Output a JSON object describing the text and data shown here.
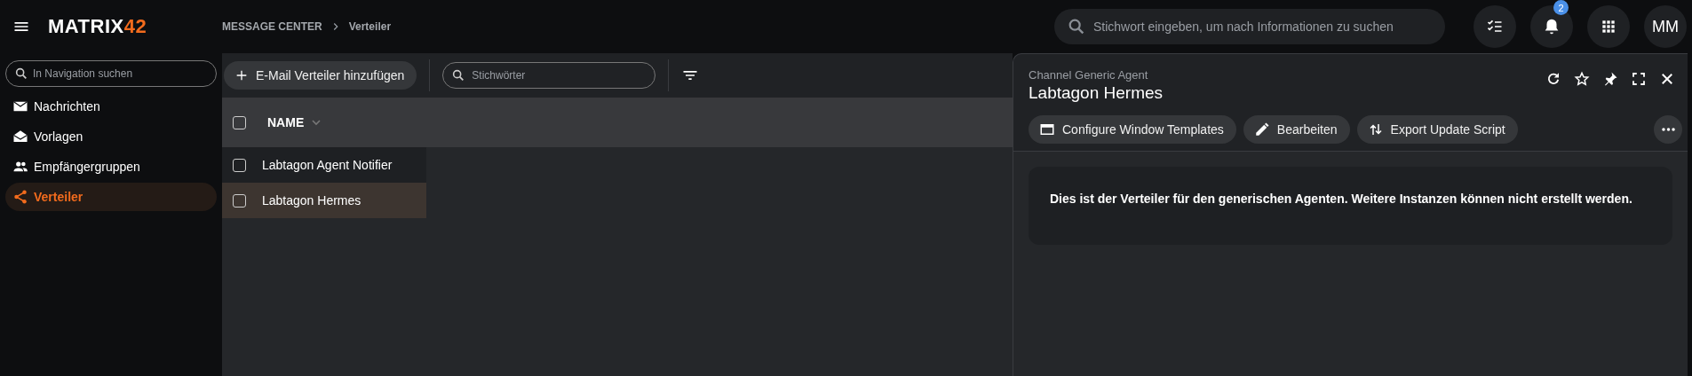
{
  "header": {
    "logo": {
      "name": "MATRIX",
      "number": "42"
    },
    "breadcrumb": [
      "MESSAGE CENTER",
      "Verteiler"
    ],
    "search": {
      "placeholder": "Stichwort eingeben, um nach Informationen zu suchen"
    },
    "notifications": {
      "count": "2"
    },
    "avatar": "MM"
  },
  "sidebar": {
    "search": {
      "placeholder": "In Navigation suchen"
    },
    "items": [
      {
        "label": "Nachrichten",
        "selected": false
      },
      {
        "label": "Vorlagen",
        "selected": false
      },
      {
        "label": "Empfängergruppen",
        "selected": false
      },
      {
        "label": "Verteiler",
        "selected": true
      }
    ]
  },
  "toolbar": {
    "add_button": "E-Mail Verteiler hinzufügen",
    "search": {
      "placeholder": "Stichwörter"
    }
  },
  "table": {
    "columns": [
      "NAME"
    ],
    "header_checked": false,
    "rows": [
      {
        "name": "Labtagon Agent Notifier",
        "checked": false,
        "selected": false
      },
      {
        "name": "Labtagon Hermes",
        "checked": false,
        "selected": true
      }
    ]
  },
  "detail": {
    "subtitle": "Channel Generic Agent",
    "title": "Labtagon Hermes",
    "actions": [
      {
        "label": "Configure Window Templates"
      },
      {
        "label": "Bearbeiten"
      },
      {
        "label": "Export Update Script"
      }
    ],
    "message": "Dies ist der Verteiler für den generischen Agenten. Weitere Instanzen können nicht erstellt werden."
  }
}
